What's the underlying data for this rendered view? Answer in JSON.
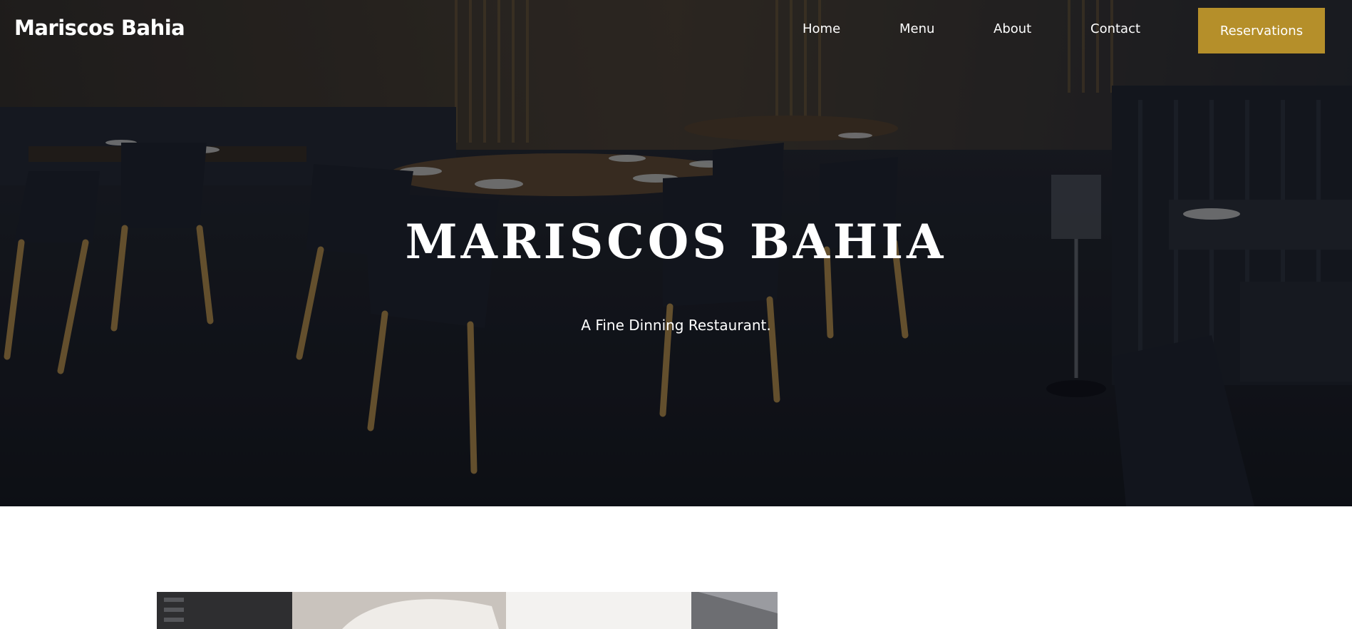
{
  "nav": {
    "brand": "Mariscos Bahia",
    "links": [
      "Home",
      "Menu",
      "About",
      "Contact"
    ],
    "cta": "Reservations"
  },
  "hero": {
    "title": "MARISCOS BAHIA",
    "subtitle": "A Fine Dinning Restaurant."
  },
  "colors": {
    "accent": "#b58f2a",
    "hero_overlay": "#1b1c22",
    "text_on_hero": "#ffffff"
  },
  "icons": {}
}
